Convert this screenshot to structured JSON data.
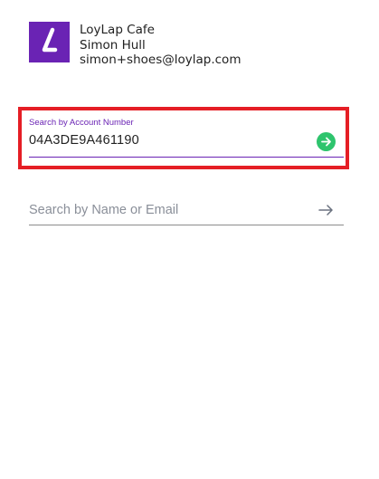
{
  "header": {
    "logo_icon": "loylap-l-logo-icon",
    "brand_color": "#6a23b4",
    "business_name": "LoyLap Cafe",
    "user_name": "Simon Hull",
    "user_email": "simon+shoes@loylap.com"
  },
  "account_search": {
    "label": "Search by Account Number",
    "value": "04A3DE9A461190",
    "submit_icon": "arrow-right-circle-icon",
    "submit_color": "#2ec46d"
  },
  "name_search": {
    "placeholder": "Search by Name or Email",
    "value": "",
    "submit_icon": "arrow-right-icon"
  },
  "highlight_color": "#e51e25"
}
